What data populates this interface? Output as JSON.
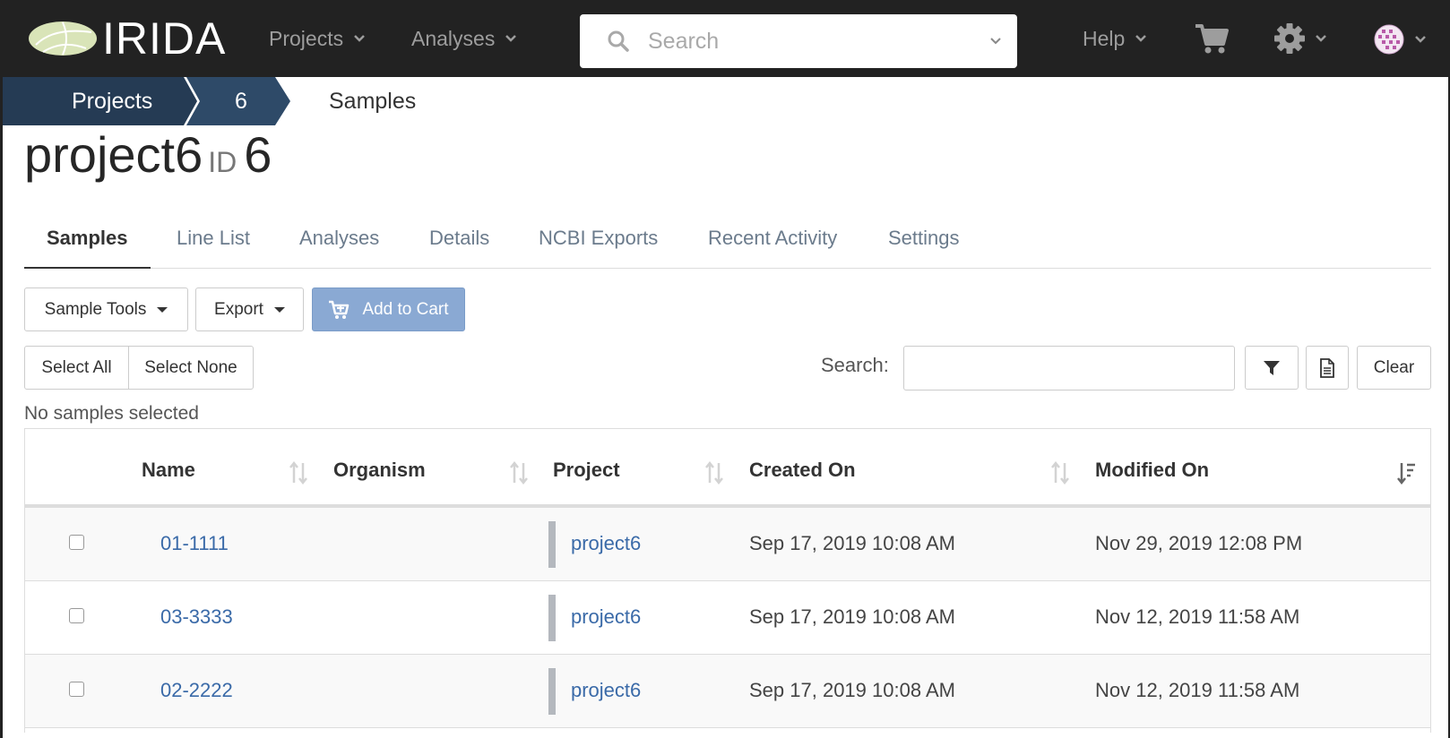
{
  "navbar": {
    "brand": "IRIDA",
    "menus": [
      {
        "label": "Projects"
      },
      {
        "label": "Analyses"
      }
    ],
    "search_placeholder": "Search",
    "help_label": "Help"
  },
  "breadcrumb": [
    "Projects",
    "6",
    "Samples"
  ],
  "page": {
    "title": "project6",
    "id_label": "ID",
    "id_value": "6"
  },
  "tabs": [
    "Samples",
    "Line List",
    "Analyses",
    "Details",
    "NCBI Exports",
    "Recent Activity",
    "Settings"
  ],
  "toolbar": {
    "sample_tools": "Sample Tools",
    "export": "Export",
    "add_to_cart": "Add to Cart",
    "select_all": "Select All",
    "select_none": "Select None",
    "search_label": "Search:",
    "clear": "Clear"
  },
  "selection_status": "No samples selected",
  "table": {
    "columns": [
      "Name",
      "Organism",
      "Project",
      "Created On",
      "Modified On"
    ],
    "rows": [
      {
        "name": "01-1111",
        "organism": "",
        "project": "project6",
        "created": "Sep 17, 2019 10:08 AM",
        "modified": "Nov 29, 2019 12:08 PM"
      },
      {
        "name": "03-3333",
        "organism": "",
        "project": "project6",
        "created": "Sep 17, 2019 10:08 AM",
        "modified": "Nov 12, 2019 11:58 AM"
      },
      {
        "name": "02-2222",
        "organism": "",
        "project": "project6",
        "created": "Sep 17, 2019 10:08 AM",
        "modified": "Nov 12, 2019 11:58 AM"
      }
    ]
  },
  "colors": {
    "navbar_bg": "#222222",
    "breadcrumb_bg": "#253b54",
    "link": "#3a6aa8",
    "primary_disabled": "#8aa9d3"
  }
}
